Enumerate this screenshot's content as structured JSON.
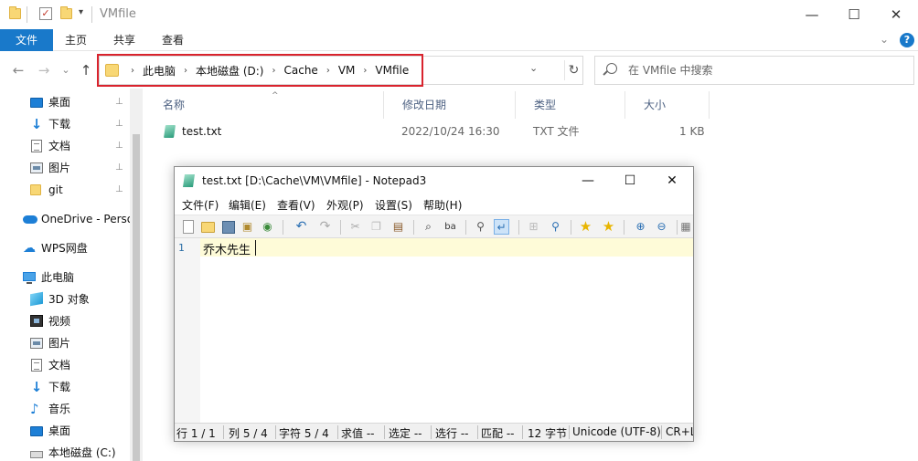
{
  "explorer": {
    "title": "VMfile",
    "window_controls": {
      "minimize": "—",
      "maximize": "☐",
      "close": "✕"
    },
    "ribbon": {
      "tabs": [
        "文件",
        "主页",
        "共享",
        "查看"
      ],
      "expand_glyph": "⌄",
      "help_glyph": "?"
    },
    "nav": {
      "back": "←",
      "forward": "→",
      "recent": "⌄",
      "up": "↑"
    },
    "breadcrumbs": [
      "此电脑",
      "本地磁盘 (D:)",
      "Cache",
      "VM",
      "VMfile"
    ],
    "breadcrumb_sep": "›",
    "address_dropdown": "⌄",
    "refresh": "↻",
    "search": {
      "placeholder": "在 VMfile 中搜索"
    },
    "sidebar": {
      "quick_access": [
        "桌面",
        "下载",
        "文档",
        "图片",
        "git"
      ],
      "pin_glyph": "📌",
      "onedrive": "OneDrive - Perso",
      "wps": "WPS网盘",
      "this_pc": "此电脑",
      "pc_items": [
        "3D 对象",
        "视频",
        "图片",
        "文档",
        "下载",
        "音乐",
        "桌面",
        "本地磁盘 (C:)"
      ]
    },
    "columns": [
      "名称",
      "修改日期",
      "类型",
      "大小"
    ],
    "sort_glyph": "^",
    "files": [
      {
        "name": "test.txt",
        "modified": "2022/10/24 16:30",
        "type": "TXT 文件",
        "size": "1 KB"
      }
    ]
  },
  "notepad": {
    "title": "test.txt [D:\\Cache\\VM\\VMfile] - Notepad3",
    "controls": {
      "minimize": "—",
      "maximize": "☐",
      "close": "✕"
    },
    "menu": [
      "文件(F)",
      "编辑(E)",
      "查看(V)",
      "外观(P)",
      "设置(S)",
      "帮助(H)"
    ],
    "lines": [
      {
        "num": "1",
        "text": "乔木先生"
      }
    ],
    "status": [
      "行  1 / 1",
      "列  5 / 4",
      "字符  5 / 4",
      "求值  --",
      "选定  --",
      "选行  --",
      "匹配  --",
      "12 字节",
      "Unicode (UTF-8)",
      "CR+LF"
    ]
  }
}
